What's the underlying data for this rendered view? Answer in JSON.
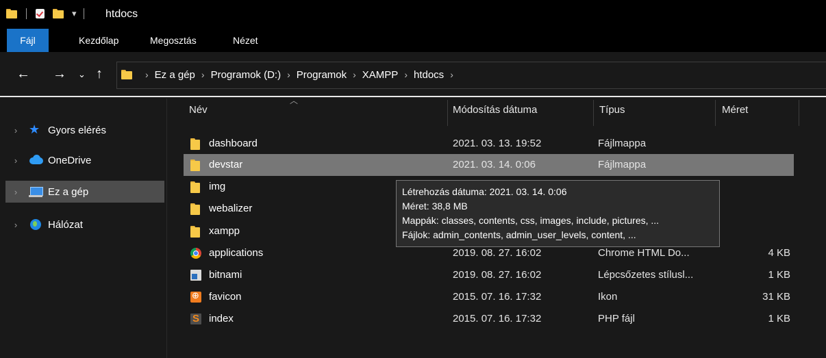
{
  "window": {
    "title": "htdocs"
  },
  "quick_access": {
    "icons": [
      "folder-icon",
      "properties-check-icon",
      "new-folder-icon",
      "customize-dropdown-icon"
    ]
  },
  "ribbon": {
    "tabs": [
      {
        "label": "Fájl",
        "active": true
      },
      {
        "label": "Kezdőlap"
      },
      {
        "label": "Megosztás"
      },
      {
        "label": "Nézet"
      }
    ],
    "active_color": "#1a73c8"
  },
  "address": {
    "crumbs": [
      "Ez a gép",
      "Programok (D:)",
      "Programok",
      "XAMPP",
      "htdocs"
    ]
  },
  "nav_pane": {
    "items": [
      {
        "label": "Gyors elérés",
        "icon": "star-icon"
      },
      {
        "label": "OneDrive",
        "icon": "cloud-icon"
      },
      {
        "label": "Ez a gép",
        "icon": "computer-icon",
        "selected": true
      },
      {
        "label": "Hálózat",
        "icon": "network-icon"
      }
    ]
  },
  "columns": {
    "name": "Név",
    "modified": "Módosítás dátuma",
    "type": "Típus",
    "size": "Méret"
  },
  "files": [
    {
      "name": "dashboard",
      "modified": "2021. 03. 13. 19:52",
      "type": "Fájlmappa",
      "size": "",
      "icon": "folder-icon"
    },
    {
      "name": "devstar",
      "modified": "2021. 03. 14. 0:06",
      "type": "Fájlmappa",
      "size": "",
      "icon": "folder-icon",
      "selected": true
    },
    {
      "name": "img",
      "modified": "",
      "type": "",
      "size": "",
      "icon": "folder-icon"
    },
    {
      "name": "webalizer",
      "modified": "",
      "type": "",
      "size": "",
      "icon": "folder-icon"
    },
    {
      "name": "xampp",
      "modified": "",
      "type": "",
      "size": "",
      "icon": "folder-icon"
    },
    {
      "name": "applications",
      "modified": "2019. 08. 27. 16:02",
      "type": "Chrome HTML Do...",
      "size": "4 KB",
      "icon": "chrome-icon"
    },
    {
      "name": "bitnami",
      "modified": "2019. 08. 27. 16:02",
      "type": "Lépcsőzetes stílusl...",
      "size": "1 KB",
      "icon": "css-file-icon"
    },
    {
      "name": "favicon",
      "modified": "2015. 07. 16. 17:32",
      "type": "Ikon",
      "size": "31 KB",
      "icon": "favicon-icon"
    },
    {
      "name": "index",
      "modified": "2015. 07. 16. 17:32",
      "type": "PHP fájl",
      "size": "1 KB",
      "icon": "php-file-icon"
    }
  ],
  "tooltip": {
    "lines": [
      "Létrehozás dátuma: 2021. 03. 14. 0:06",
      "Méret: 38,8 MB",
      "Mappák: classes, contents, css, images, include, pictures, ...",
      "Fájlok: admin_contents, admin_user_levels, content, ..."
    ]
  }
}
